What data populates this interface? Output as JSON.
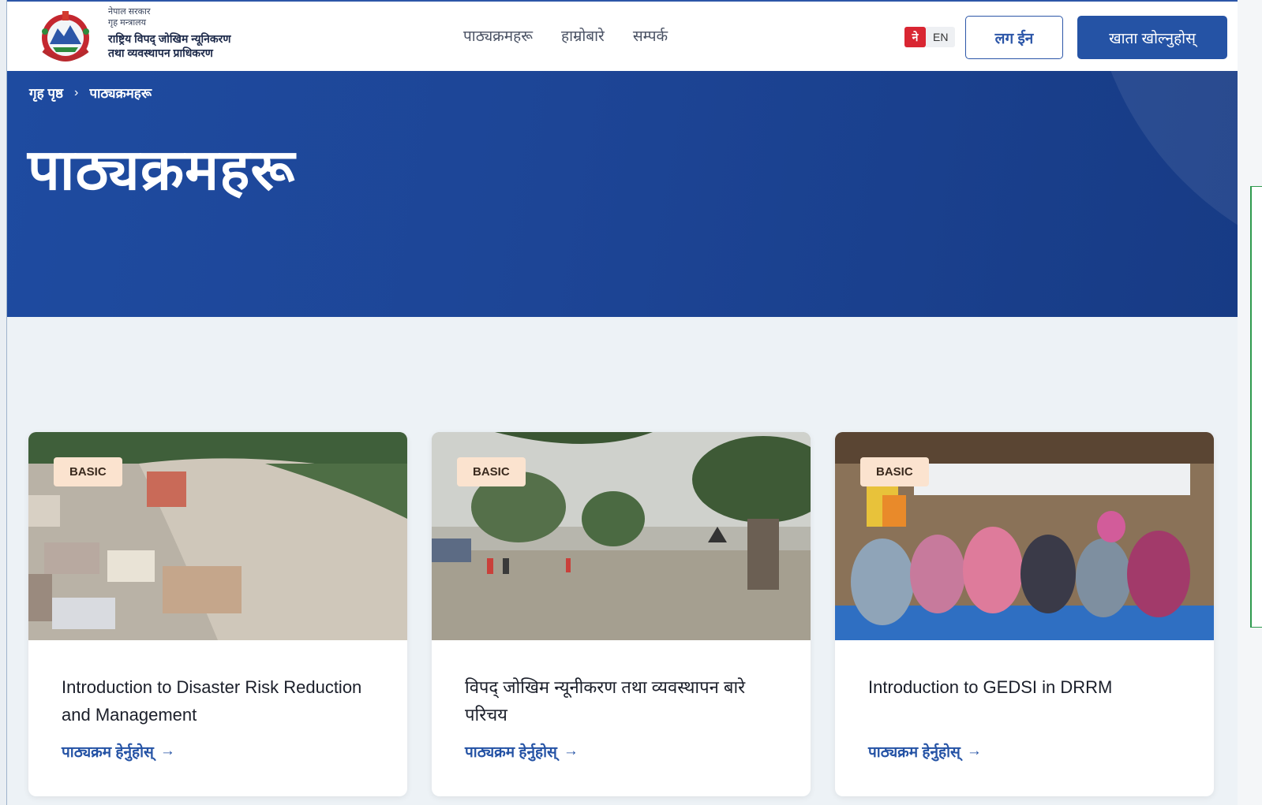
{
  "header": {
    "org_line1": "नेपाल सरकार",
    "org_line2": "गृह मन्त्रालय",
    "org_line3": "राष्ट्रिय विपद् जोखिम न्यूनिकरण",
    "org_line4": "तथा व्यवस्थापन प्राधिकरण",
    "nav": [
      {
        "label": "पाठ्यक्रमहरू"
      },
      {
        "label": "हाम्रोबारे"
      },
      {
        "label": "सम्पर्क"
      }
    ],
    "lang_ne": "ने",
    "lang_en": "EN",
    "login_label": "लग ईन",
    "signup_label": "खाता खोल्नुहोस्"
  },
  "hero": {
    "breadcrumb_home": "गृह पृष्ठ",
    "breadcrumb_sep": "›",
    "breadcrumb_current": "पाठ्यक्रमहरू",
    "title": "पाठ्यक्रमहरू"
  },
  "cards": [
    {
      "badge": "BASIC",
      "title": "Introduction to Disaster Risk Reduction and Management",
      "link": "पाठ्यक्रम हेर्नुहोस्",
      "arrow": "→",
      "image": "flood-town-aerial"
    },
    {
      "badge": "BASIC",
      "title": "विपद् जोखिम न्यूनीकरण तथा व्यवस्थापन बारे परिचय",
      "link": "पाठ्यक्रम हेर्नुहोस्",
      "arrow": "→",
      "image": "flooded-road"
    },
    {
      "badge": "BASIC",
      "title": "Introduction to GEDSI in DRRM",
      "link": "पाठ्यक्रम हेर्नुहोस्",
      "arrow": "→",
      "image": "community-meeting"
    }
  ],
  "colors": {
    "primary": "#2553a5",
    "hero": "#1d4596",
    "badge": "#fbe3cf",
    "flag_red": "#d92632"
  }
}
